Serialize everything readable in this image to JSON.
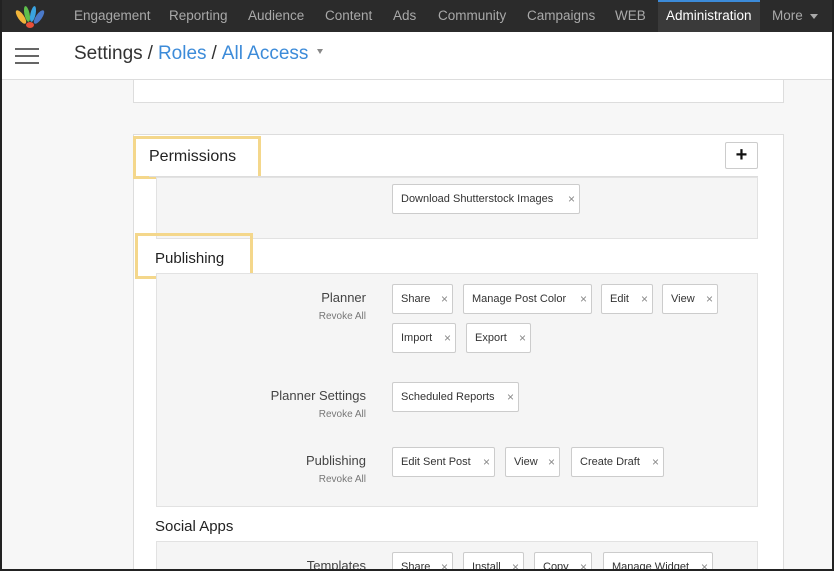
{
  "nav": {
    "items": [
      "Engagement",
      "Reporting",
      "Audience",
      "Content",
      "Ads",
      "Community",
      "Campaigns",
      "WEB",
      "Administration",
      "More"
    ],
    "active": "Administration",
    "accent": "#3c8bd9"
  },
  "header": {
    "settings": "Settings",
    "roles": "Roles",
    "role": "All Access",
    "separator": "/"
  },
  "permissions": {
    "title": "Permissions",
    "add_label": "+",
    "prev_tags": [
      "Download Shutterstock Images"
    ]
  },
  "publishing": {
    "title": "Publishing",
    "groups": [
      {
        "label": "Planner",
        "revoke": "Revoke All",
        "tags": [
          "Share",
          "Manage Post Color",
          "Edit",
          "View",
          "Import",
          "Export"
        ]
      },
      {
        "label": "Planner Settings",
        "revoke": "Revoke All",
        "tags": [
          "Scheduled Reports"
        ]
      },
      {
        "label": "Publishing",
        "revoke": "Revoke All",
        "tags": [
          "Edit Sent Post",
          "View",
          "Create Draft"
        ]
      }
    ]
  },
  "social_apps": {
    "title": "Social Apps",
    "groups": [
      {
        "label": "Templates",
        "tags": [
          "Share",
          "Install",
          "Copy",
          "Manage Widget"
        ]
      }
    ]
  },
  "remove_icon": "×",
  "colors": {
    "highlight": "#f4d78b",
    "topbar": "#2b2b2b"
  }
}
